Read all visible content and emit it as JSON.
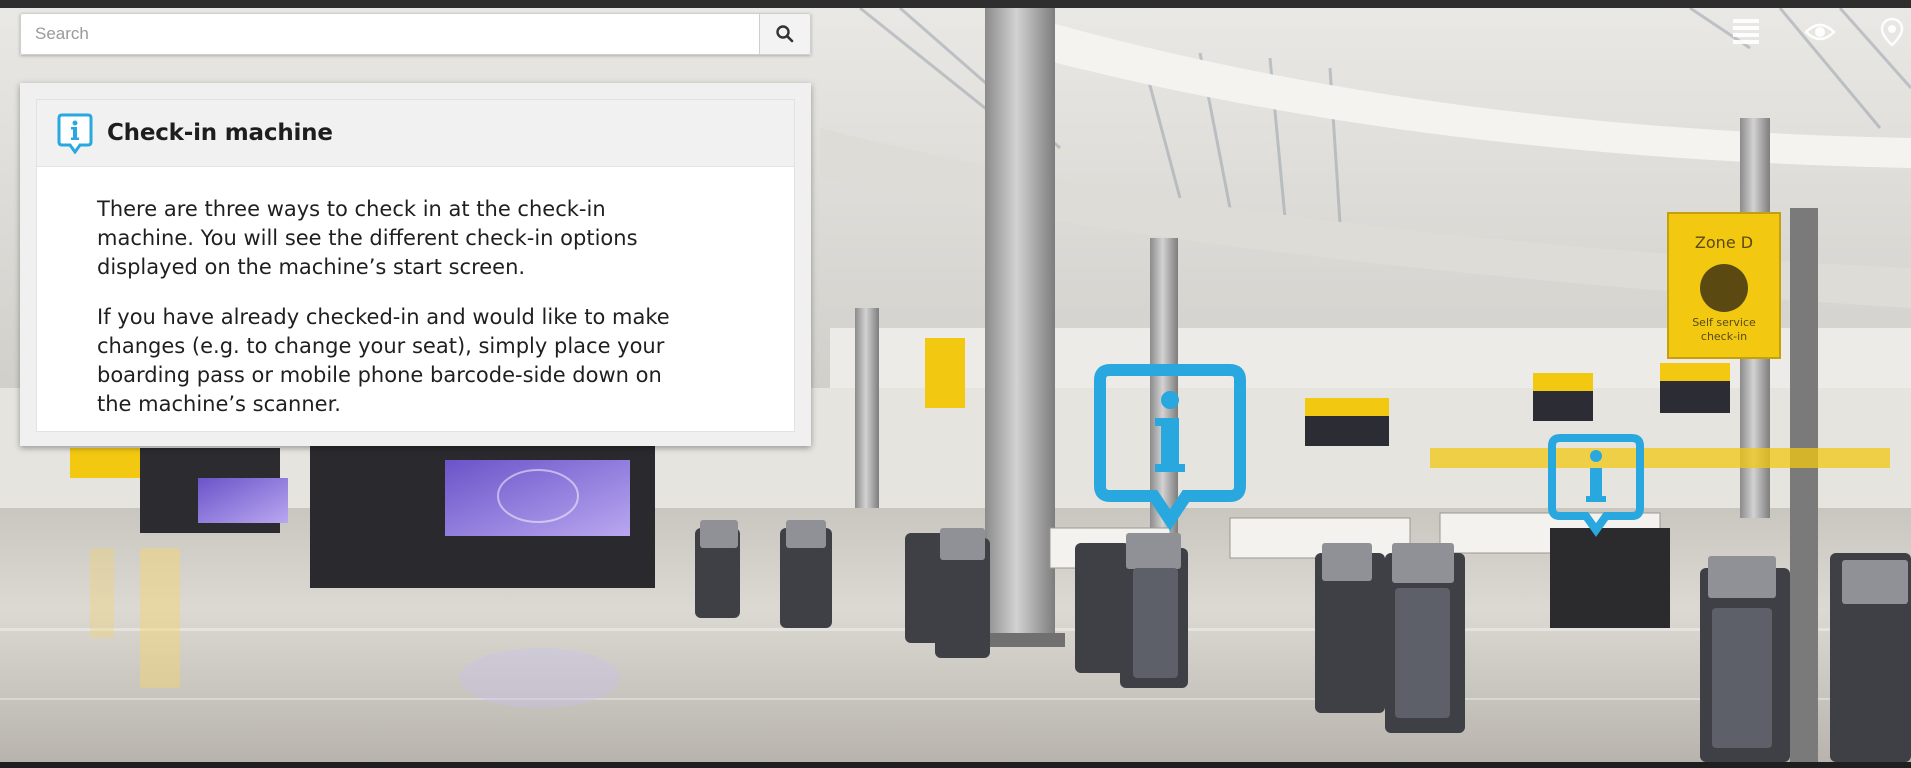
{
  "search": {
    "placeholder": "Search",
    "button_icon": "search-icon"
  },
  "info_panel": {
    "icon": "info-speech-icon",
    "title": "Check-in machine",
    "paragraphs": [
      "There are three ways to check in at the check-in machine. You will see the different check-in options displayed on the machine’s start screen.",
      "If you have already checked-in and would like to make changes (e.g. to change your seat), simply place your boarding pass or mobile phone barcode-side down on the machine’s scanner."
    ]
  },
  "toolbar": {
    "menu_icon": "menu-icon",
    "view_icon": "eye-icon",
    "location_icon": "location-pin-icon"
  },
  "scene": {
    "zone_sign_title": "Zone D",
    "zone_sign_caption_1": "Self service",
    "zone_sign_caption_2": "check-in",
    "hotspot_icon": "info-hotspot-icon"
  },
  "colors": {
    "accent": "#29a8e0",
    "sign_yellow": "#f2c811"
  }
}
